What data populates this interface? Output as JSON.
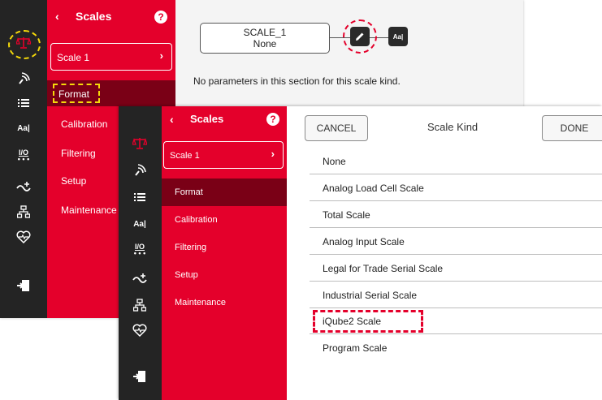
{
  "back_panel": {
    "header_title": "Scales",
    "help_icon": "question-circle-icon",
    "scale_item": "Scale 1",
    "menu": [
      "Format",
      "Calibration",
      "Filtering",
      "Setup",
      "Maintenance"
    ],
    "scale_box": {
      "name": "SCALE_1",
      "kind": "None"
    },
    "edit_icon": "pencil-icon",
    "font_icon_label": "Aa|",
    "message": "No parameters in this section for this scale kind."
  },
  "front_panel": {
    "header_title": "Scales",
    "help_icon": "question-circle-icon",
    "scale_item": "Scale 1",
    "menu": [
      "Format",
      "Calibration",
      "Filtering",
      "Setup",
      "Maintenance"
    ],
    "cancel_label": "CANCEL",
    "dialog_title": "Scale Kind",
    "done_label": "DONE",
    "scale_kinds": [
      "None",
      "Analog Load Cell Scale",
      "Total Scale",
      "Analog Input Scale",
      "Legal for Trade Serial Scale",
      "Industrial Serial Scale",
      "iQube2 Scale",
      "Program Scale"
    ]
  },
  "rail": {
    "icons": [
      "scale-icon",
      "signal-icon",
      "list-icon",
      "font-size-icon",
      "io-icon",
      "connection-icon",
      "network-icon",
      "health-icon",
      "logout-icon"
    ],
    "font_label": "Aa|",
    "io_label": "I/O"
  },
  "colors": {
    "brand_red": "#e4002b",
    "dark_red": "#7a0016",
    "rail": "#242424",
    "highlight_yellow": "#f5d90a",
    "annotation_red": "#e4002b"
  }
}
